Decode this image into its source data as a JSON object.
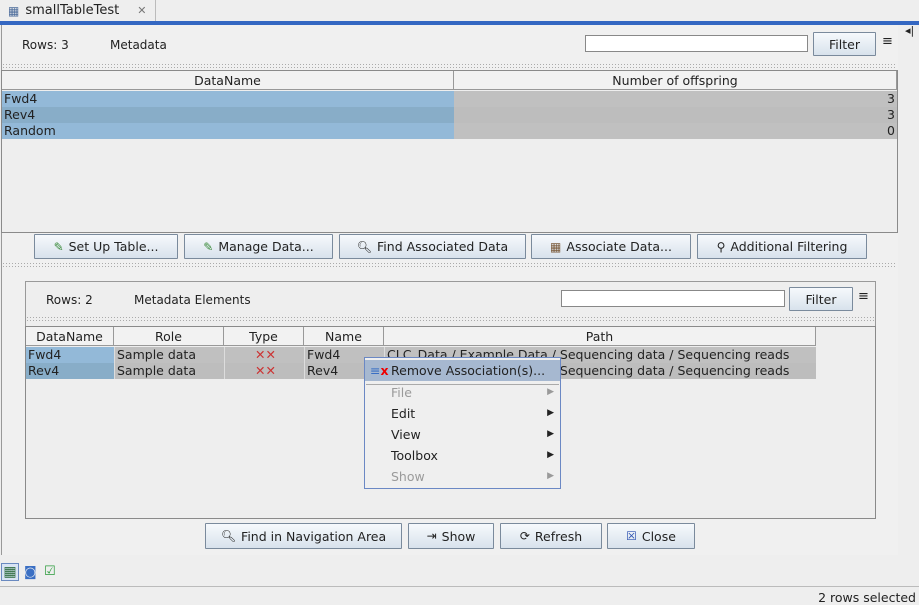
{
  "tab": {
    "title": "smallTableTest",
    "close": "✕"
  },
  "top": {
    "rows": "Rows: 3",
    "title": "Metadata",
    "filter_value": "",
    "filter_button": "Filter",
    "columns": [
      "DataName",
      "Number of offspring"
    ],
    "rows_data": [
      [
        "Fwd4",
        "3"
      ],
      [
        "Rev4",
        "3"
      ],
      [
        "Random",
        "0"
      ]
    ]
  },
  "buttons": [
    "Set Up Table...",
    "Manage Data...",
    "Find Associated Data",
    "Associate Data...",
    "Additional Filtering"
  ],
  "lower": {
    "rows": "Rows: 2",
    "title": "Metadata Elements",
    "filter_value": "",
    "filter_button": "Filter",
    "columns": [
      "DataName",
      "Role",
      "Type",
      "Name",
      "Path"
    ],
    "rows_data": [
      [
        "Fwd4",
        "Sample data",
        "",
        "Fwd4",
        "CLC_Data / Example Data / Sequencing data / Sequencing reads"
      ],
      [
        "Rev4",
        "Sample data",
        "",
        "Rev4",
        "CLC_Data / Example Data / Sequencing data / Sequencing reads"
      ]
    ]
  },
  "context_menu": {
    "items": [
      {
        "label": "Remove Association(s)...",
        "enabled": true
      },
      {
        "label": "File",
        "enabled": false
      },
      {
        "label": "Edit",
        "enabled": true
      },
      {
        "label": "View",
        "enabled": true
      },
      {
        "label": "Toolbox",
        "enabled": true
      },
      {
        "label": "Show",
        "enabled": false
      }
    ]
  },
  "bottom_buttons": [
    "Find in Navigation Area",
    "Show",
    "Refresh",
    "Close"
  ],
  "status": "2 rows selected",
  "colors": {
    "accent": "#3467c2",
    "selection": "#93b9d8",
    "selection_alt": "#88adc8",
    "gray_cell": "#c0c0c0"
  }
}
